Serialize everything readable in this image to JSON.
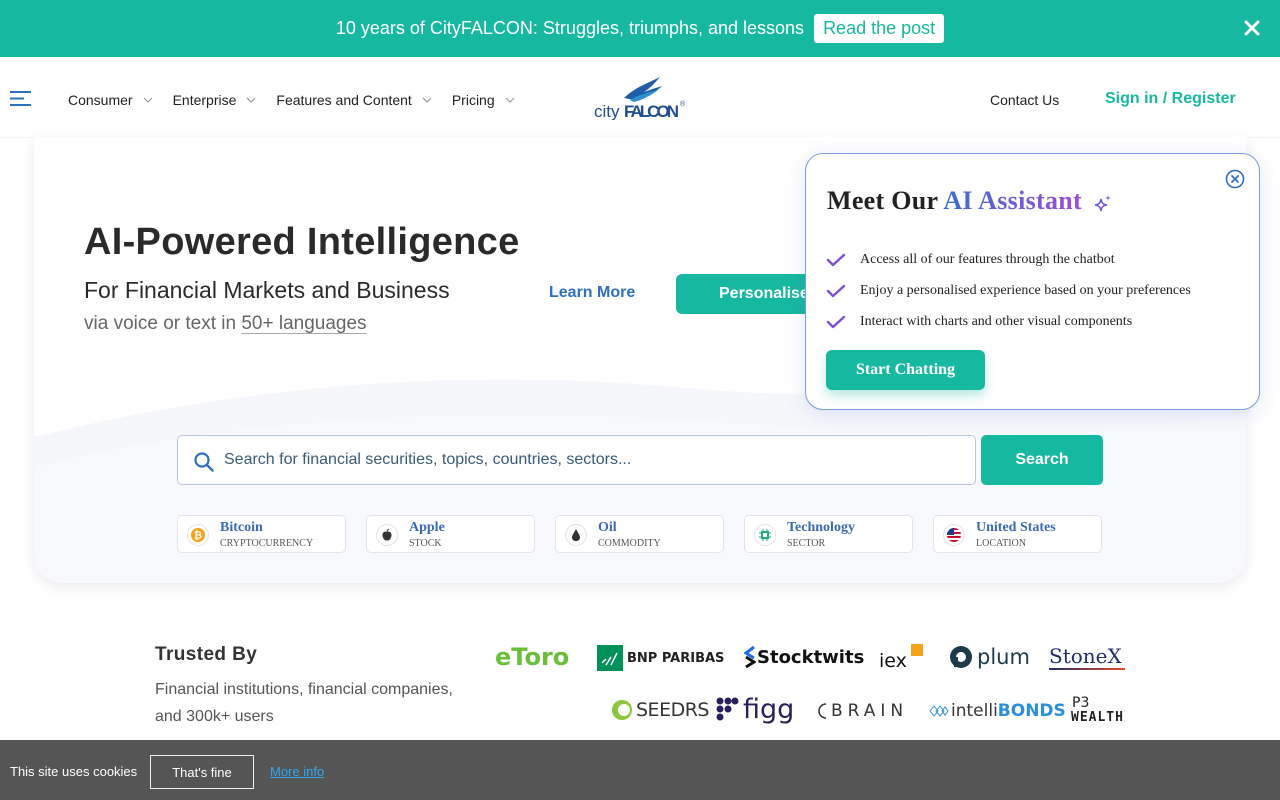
{
  "banner": {
    "text": "10 years of CityFALCON: Struggles, triumphs, and lessons",
    "button": "Read the post",
    "close_icon": "close-icon"
  },
  "nav": {
    "items": [
      {
        "label": "Consumer"
      },
      {
        "label": "Enterprise"
      },
      {
        "label": "Features and Content"
      },
      {
        "label": "Pricing"
      }
    ],
    "logo_city": "city",
    "logo_falcon": "FALCON",
    "logo_mark": "®",
    "contact": "Contact Us",
    "signin": "Sign in / Register"
  },
  "hero": {
    "title": "AI-Powered Intelligence",
    "subtitle": "For Financial Markets and Business",
    "subtitle2_prefix": "via voice or text in",
    "subtitle2_link": "50+ languages",
    "learn_more": "Learn More",
    "personalise": "Personalise"
  },
  "search": {
    "placeholder": "Search for financial securities, topics, countries, sectors...",
    "button": "Search"
  },
  "chips": [
    {
      "name": "Bitcoin",
      "type": "CRYPTOCURRENCY",
      "icon": "bitcoin-icon"
    },
    {
      "name": "Apple",
      "type": "STOCK",
      "icon": "apple-icon"
    },
    {
      "name": "Oil",
      "type": "COMMODITY",
      "icon": "oil-drop-icon"
    },
    {
      "name": "Technology",
      "type": "SECTOR",
      "icon": "chip-icon"
    },
    {
      "name": "United States",
      "type": "LOCATION",
      "icon": "us-flag-icon"
    }
  ],
  "trusted": {
    "title": "Trusted By",
    "description": "Financial institutions, financial companies, and 300k+ users",
    "brands": [
      "eToro",
      "BNP PARIBAS",
      "Stocktwits",
      "iex",
      "plum",
      "StoneX",
      "SEEDRS",
      "figg",
      "BRAIN",
      "intelliBONDS",
      "P3 WEALTH"
    ],
    "brand_text": {
      "etoro": "eToro",
      "bnp": "BNP PARIBAS",
      "stocktwits": "Stocktwits",
      "iex": "iex",
      "plum": "plum",
      "stonex": "StoneX",
      "seedrs": "SEEDRS",
      "figg": "figg",
      "brain": "BRAIN",
      "intelli": "intelli",
      "bonds": "BONDS",
      "p3": "P3",
      "wealth": "WEALTH"
    }
  },
  "popup": {
    "title_prefix": "Meet Our",
    "title_highlight": "AI Assistant",
    "items": [
      "Access all of our features through the chatbot",
      "Enjoy a personalised experience based on your preferences",
      "Interact with charts and other visual components"
    ],
    "button": "Start Chatting"
  },
  "cookie": {
    "text": "This site uses cookies",
    "button": "That's fine",
    "more": "More info"
  },
  "colors": {
    "accent": "#17b8a0",
    "link_blue": "#2f6fc0",
    "cookie_bg": "#555555"
  }
}
